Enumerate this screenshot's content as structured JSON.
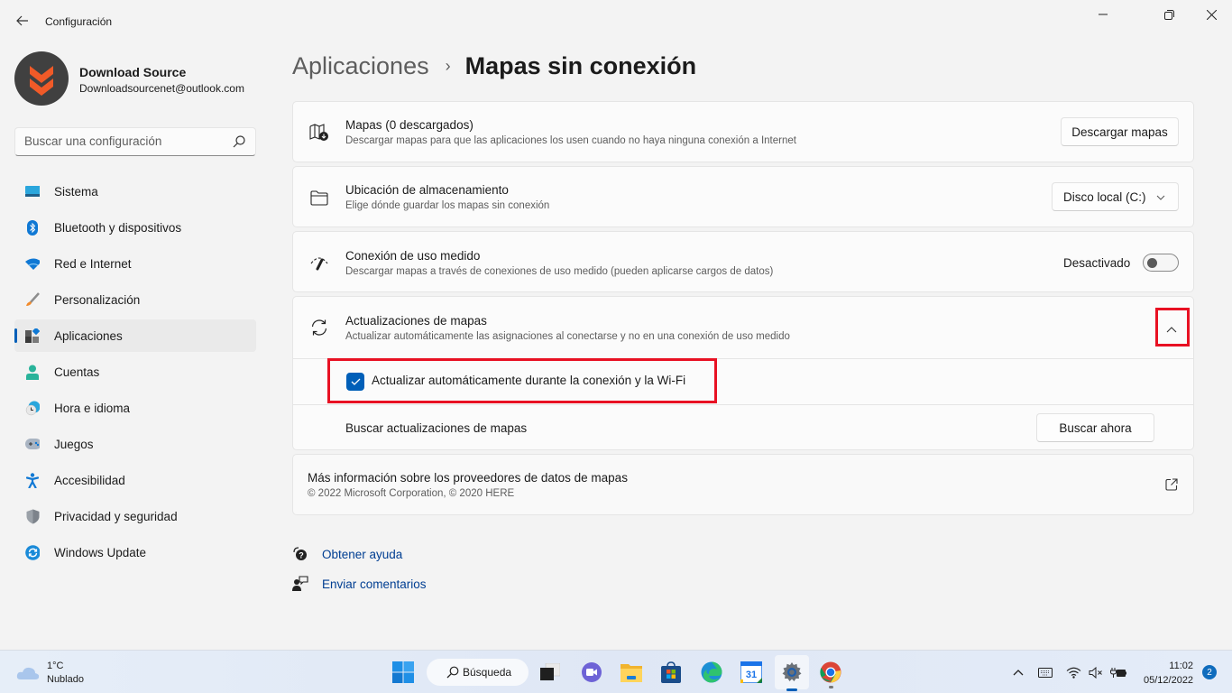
{
  "window": {
    "title": "Configuración",
    "back_icon": "arrow-left-icon",
    "controls": [
      "minimize-icon",
      "restore-icon",
      "close-icon"
    ]
  },
  "profile": {
    "name": "Download Source",
    "email": "Downloadsourcenet@outlook.com"
  },
  "search": {
    "placeholder": "Buscar una configuración",
    "value": ""
  },
  "sidebar": {
    "items": [
      {
        "label": "Sistema",
        "icon": "system-icon",
        "active": false
      },
      {
        "label": "Bluetooth y dispositivos",
        "icon": "bluetooth-icon",
        "active": false
      },
      {
        "label": "Red e Internet",
        "icon": "wifi-icon",
        "active": false
      },
      {
        "label": "Personalización",
        "icon": "brush-icon",
        "active": false
      },
      {
        "label": "Aplicaciones",
        "icon": "apps-icon",
        "active": true
      },
      {
        "label": "Cuentas",
        "icon": "person-icon",
        "active": false
      },
      {
        "label": "Hora e idioma",
        "icon": "clock-globe-icon",
        "active": false
      },
      {
        "label": "Juegos",
        "icon": "gamepad-icon",
        "active": false
      },
      {
        "label": "Accesibilidad",
        "icon": "accessibility-icon",
        "active": false
      },
      {
        "label": "Privacidad y seguridad",
        "icon": "shield-icon",
        "active": false
      },
      {
        "label": "Windows Update",
        "icon": "update-icon",
        "active": false
      }
    ]
  },
  "breadcrumb": {
    "parent": "Aplicaciones",
    "separator": "›",
    "current": "Mapas sin conexión"
  },
  "cards": {
    "maps": {
      "title": "Mapas (0 descargados)",
      "subtitle": "Descargar mapas para que las aplicaciones los usen cuando no haya ninguna conexión a Internet",
      "button": "Descargar mapas"
    },
    "storage": {
      "title": "Ubicación de almacenamiento",
      "subtitle": "Elige dónde guardar los mapas sin conexión",
      "selected": "Disco local (C:)"
    },
    "metered": {
      "title": "Conexión de uso medido",
      "subtitle": "Descargar mapas a través de conexiones de uso medido (pueden aplicarse cargos de datos)",
      "state_label": "Desactivado",
      "on": false
    },
    "updates": {
      "title": "Actualizaciones de mapas",
      "subtitle": "Actualizar automáticamente las asignaciones al conectarse y no en una conexión de uso medido",
      "expanded": true,
      "checkbox_label": "Actualizar automáticamente durante la conexión y la Wi-Fi",
      "checkbox_checked": true,
      "check_label": "Buscar actualizaciones de mapas",
      "check_button": "Buscar ahora"
    },
    "info": {
      "title": "Más información sobre los proveedores de datos de mapas",
      "subtitle": "© 2022 Microsoft Corporation, © 2020 HERE"
    }
  },
  "links": {
    "help": "Obtener ayuda",
    "feedback": "Enviar comentarios"
  },
  "taskbar": {
    "weather_temp": "1°C",
    "weather_desc": "Nublado",
    "search_label": "Búsqueda",
    "apps": [
      "task-view",
      "teams-chat",
      "file-explorer",
      "microsoft-store",
      "edge",
      "calendar",
      "settings",
      "chrome"
    ],
    "calendar_day": "31",
    "time": "11:02",
    "date": "05/12/2022",
    "notifications": "2"
  },
  "colors": {
    "accent": "#005fb8",
    "highlight": "#e81123",
    "link": "#003e92",
    "avatar_orange": "#f05a28"
  }
}
